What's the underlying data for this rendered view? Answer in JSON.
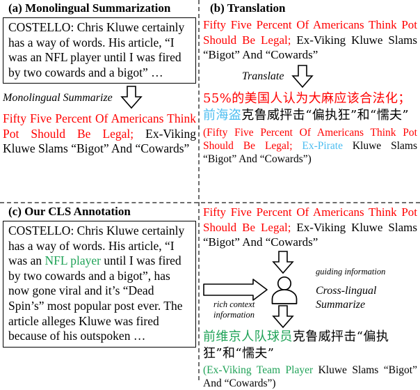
{
  "figure": {
    "panels": {
      "a": {
        "title": "(a) Monolingual Summarization",
        "article": {
          "speaker": "COSTELLO:",
          "text": " Chris Kluwe certainly has a way of words. His article, “I was an NFL player until I was fired by two cowards and a bigot” …"
        },
        "operation_label": "Monolingual Summarize",
        "summary": {
          "highlight": "Fifty Five Percent Of Americans Think Pot Should Be Legal;",
          "rest": " Ex-Viking Kluwe Slams “Bigot” And “Cowards”"
        }
      },
      "b": {
        "title": "(b) Translation",
        "source_summary": {
          "highlight": "Fifty Five Percent Of Americans Think Pot Should Be Legal;",
          "rest": " Ex-Viking Kluwe Slams “Bigot” And “Cowards”"
        },
        "operation_label": "Translate",
        "translation_cn": {
          "red": "55%的美国人认为大麻应该合法化；",
          "blue": "前海盗",
          "black": "克鲁威抨击“偏执狂”和“懦夫”"
        },
        "gloss": {
          "open": "(",
          "red": "Fifty Five Percent Of Americans Think Pot Should Be Legal;",
          "blue": " Ex-Pirate",
          "black": " Kluwe Slams “Bigot” And “Cowards”)"
        }
      },
      "c": {
        "title": "(c) Our CLS Annotation",
        "article": {
          "part1": "COSTELLO: Chris Kluwe certainly has a way of words. His article, “I was an ",
          "highlight": "NFL player",
          "part2": " until I was fired by two cowards and a bigot”,  has now gone viral and it’s “Dead Spin’s” most popular post ever. The article alleges Kluwe was fired because of his outspoken …"
        }
      },
      "d": {
        "source_summary": {
          "highlight": "Fifty Five Percent Of Americans Think Pot Should Be Legal;",
          "rest": " Ex-Viking Kluwe Slams “Bigot” And “Cowards”"
        },
        "label_guiding": "guiding information",
        "label_rich_line1": "rich context",
        "label_rich_line2": "information",
        "label_operation_line1": "Cross-lingual",
        "label_operation_line2": "Summarize",
        "output_cn": {
          "green": "前维京人队球员",
          "black": "克鲁威抨击“偏执狂”和“懦夫”"
        },
        "gloss": {
          "open": "(",
          "green": "Ex-Viking Team Player",
          "black": " Kluwe Slams “Bigot” And “Cowards”)"
        }
      }
    },
    "colors": {
      "highlight_red": "#ff0000",
      "entity_blue": "#4cbdf0",
      "entity_green": "#1fa257",
      "divider_gray": "#6d6d6d",
      "text_black": "#000000"
    },
    "icons": {
      "arrow_down": "arrow-down-icon",
      "arrow_right": "arrow-right-icon",
      "person": "person-icon"
    }
  }
}
